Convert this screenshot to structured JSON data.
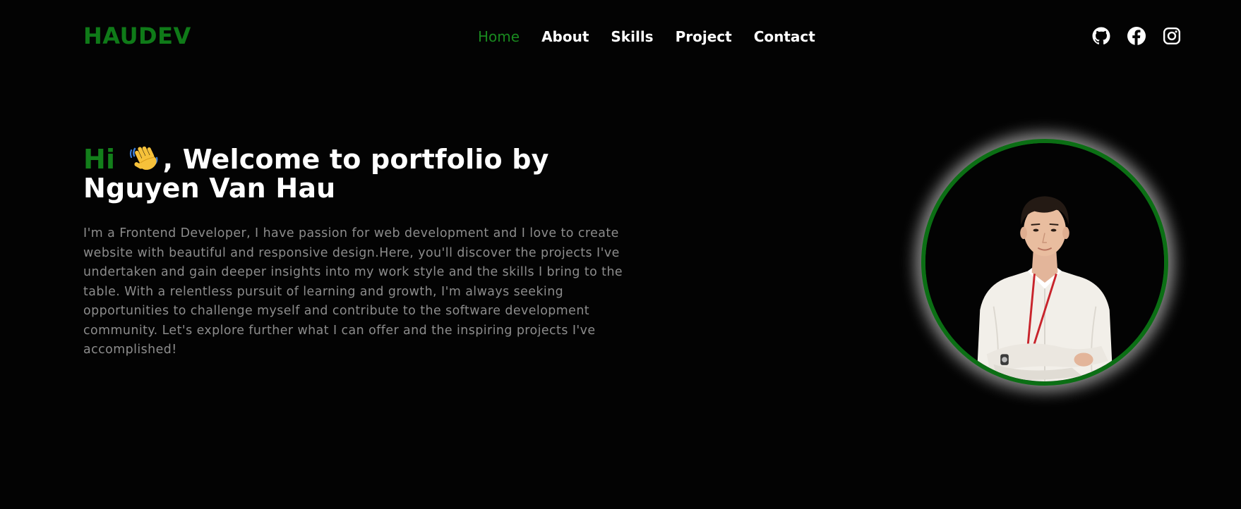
{
  "header": {
    "logo": "HAUDEV",
    "nav": [
      {
        "label": "Home",
        "active": true
      },
      {
        "label": "About",
        "active": false
      },
      {
        "label": "Skills",
        "active": false
      },
      {
        "label": "Project",
        "active": false
      },
      {
        "label": "Contact",
        "active": false
      }
    ],
    "social": [
      "github-icon",
      "facebook-icon",
      "instagram-icon"
    ]
  },
  "hero": {
    "greeting": "Hi",
    "wave_icon": "waving-hand-icon",
    "title_rest_line1": ", Welcome to portfolio by",
    "title_line2": "Nguyen Van Hau",
    "bio": "I'm a Frontend Developer, I have passion for web development and I love to create website with beautiful and responsive design.Here, you'll discover the projects I've undertaken and gain deeper insights into my work style and the skills I bring to the table. With a relentless pursuit of learning and growth, I'm always seeking opportunities to challenge myself and contribute to the software development community. Let's explore further what I can offer and the inspiring projects I've accomplished!"
  },
  "colors": {
    "accent": "#137f1b",
    "background": "#030303",
    "text": "#ffffff",
    "muted": "#8c8c8c"
  }
}
